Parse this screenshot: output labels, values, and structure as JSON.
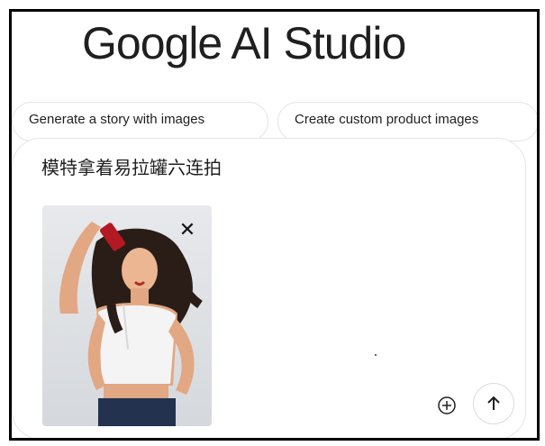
{
  "header": {
    "logo_text": "Google AI Studio"
  },
  "suggestions": [
    {
      "label": "Generate a story with images"
    },
    {
      "label": "Create custom product images"
    }
  ],
  "prompt": {
    "text": "模特拿着易拉罐六连拍",
    "attachment": {
      "remove_icon": "close-icon",
      "alt": "model-holding-can-photo"
    }
  },
  "actions": {
    "add_icon": "add-circle-icon",
    "send_icon": "arrow-up-icon"
  }
}
